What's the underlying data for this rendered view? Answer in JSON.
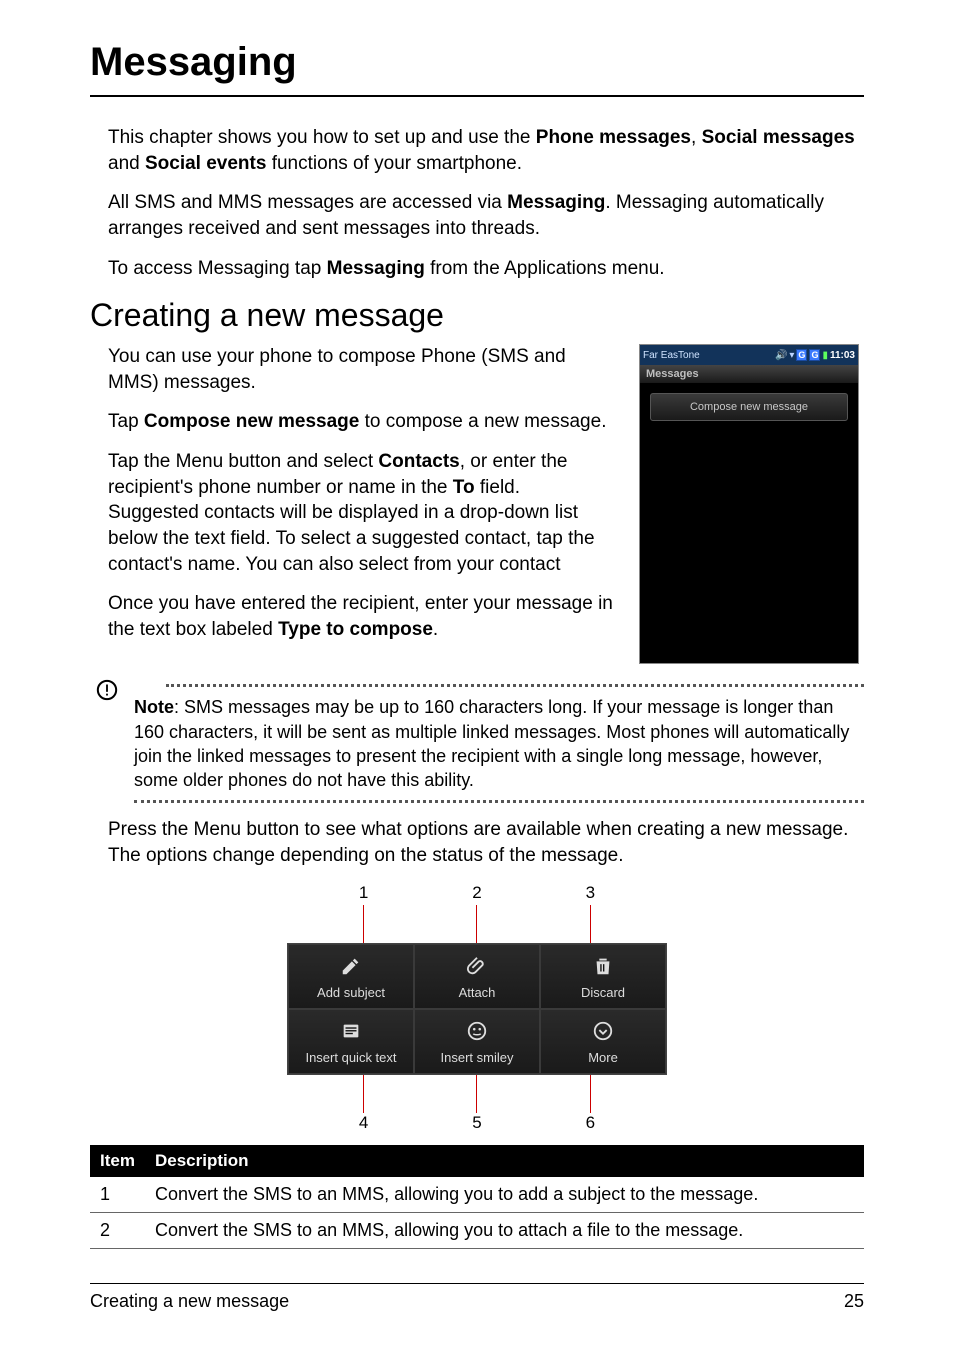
{
  "chapter_title": "Messaging",
  "intro": {
    "p1_prefix": "This chapter shows you how to set up and use the ",
    "p1_b1": "Phone messages",
    "p1_mid1": ", ",
    "p1_b2": "Social messages",
    "p1_mid2": " and ",
    "p1_b3": "Social events",
    "p1_suffix": " functions of your smartphone.",
    "p2_prefix": "All SMS and MMS messages are accessed via ",
    "p2_b1": "Messaging",
    "p2_suffix": ". Messaging automatically arranges received and sent messages into threads.",
    "p3_prefix": "To access Messaging tap ",
    "p3_b1": "Messaging",
    "p3_suffix": " from the Applications menu."
  },
  "section_title": "Creating a new message",
  "section": {
    "p1": "You can use your phone to compose Phone (SMS and MMS) messages.",
    "p2_prefix": "Tap ",
    "p2_b1": "Compose new message",
    "p2_suffix": " to compose a new message.",
    "p3_prefix": "Tap the Menu button and select ",
    "p3_b1": "Contacts",
    "p3_mid": ", or enter the recipient's phone number or name in the ",
    "p3_b2": "To",
    "p3_suffix": " field. Suggested contacts will be displayed in a drop-down list below the text field. To select a suggested contact, tap the contact's name. You can also select from your contact",
    "p4_prefix": "Once you have entered the recipient, enter your message in the text box labeled ",
    "p4_b1": "Type to compose",
    "p4_suffix": "."
  },
  "screenshot": {
    "carrier": "Far EasTone",
    "time": "11:03",
    "header": "Messages",
    "compose_btn": "Compose new message",
    "g_badge": "G"
  },
  "note": {
    "label": "Note",
    "text": ": SMS messages may be up to 160 characters long. If your message is longer than 160 characters, it will be sent as multiple linked messages. Most phones will automatically join the linked messages to present the recipient with a single long message, however, some older phones do not have this ability."
  },
  "after_note": "Press the Menu button to see what options are available when creating a new message. The options change depending on the status of the message.",
  "diagram": {
    "nums_top": [
      "1",
      "2",
      "3"
    ],
    "nums_bottom": [
      "4",
      "5",
      "6"
    ],
    "cells_row1": [
      "Add subject",
      "Attach",
      "Discard"
    ],
    "cells_row2": [
      "Insert quick text",
      "Insert smiley",
      "More"
    ]
  },
  "table": {
    "headers": [
      "Item",
      "Description"
    ],
    "rows": [
      [
        "1",
        "Convert the SMS to an MMS, allowing you to add a subject to the message."
      ],
      [
        "2",
        "Convert the SMS to an MMS, allowing you to attach a file to the message."
      ]
    ]
  },
  "footer": {
    "left": "Creating a new message",
    "right": "25"
  }
}
